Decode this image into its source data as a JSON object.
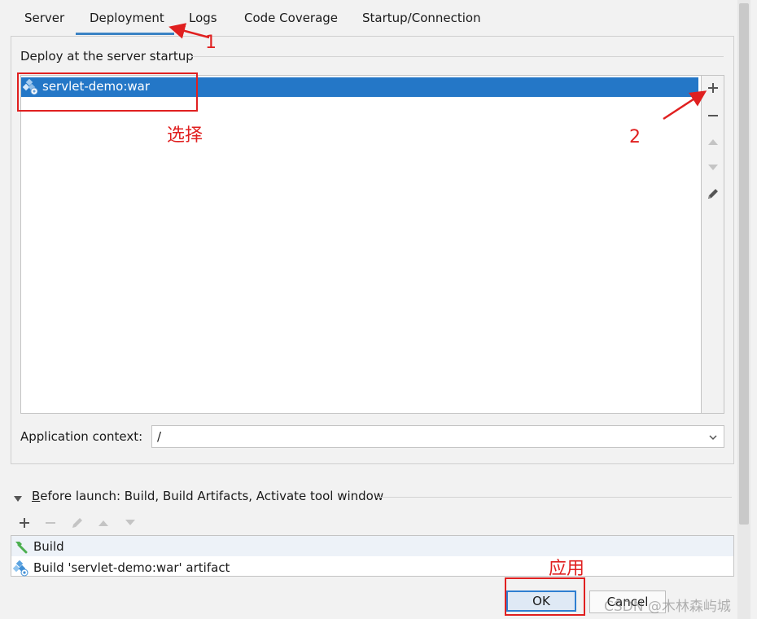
{
  "tabs": [
    {
      "label": "Server"
    },
    {
      "label": "Deployment",
      "selected": true
    },
    {
      "label": "Logs"
    },
    {
      "label": "Code Coverage"
    },
    {
      "label": "Startup/Connection"
    }
  ],
  "deploy": {
    "group_title": "Deploy at the server startup",
    "items": [
      {
        "label": "servlet-demo:war",
        "selected": true,
        "icon": "artifact-icon"
      }
    ],
    "toolbar": [
      "add-icon",
      "remove-icon",
      "move-up-icon",
      "move-down-icon",
      "edit-icon"
    ]
  },
  "app_context": {
    "label": "Application context:",
    "value": "/"
  },
  "before_launch": {
    "title": "Before launch: Build, Build Artifacts, Activate tool window",
    "title_mnemonic": "B",
    "title_rest": "efore launch: Build, Build Artifacts, Activate tool window",
    "toolbar": [
      "add-icon",
      "remove-icon",
      "edit-icon",
      "move-up-icon",
      "move-down-icon"
    ],
    "items": [
      {
        "label": "Build",
        "icon": "hammer-icon"
      },
      {
        "label": "Build 'servlet-demo:war' artifact",
        "icon": "artifact-icon"
      }
    ]
  },
  "buttons": {
    "ok": "OK",
    "cancel": "Cancel"
  },
  "watermark": "CSDN @木林森屿城",
  "annotations": {
    "step1": "1",
    "step2": "2",
    "select": "选择",
    "apply": "应用"
  },
  "colors": {
    "selection": "#2477c7",
    "tab_underline": "#3b83c4",
    "annotation": "#e02020"
  }
}
